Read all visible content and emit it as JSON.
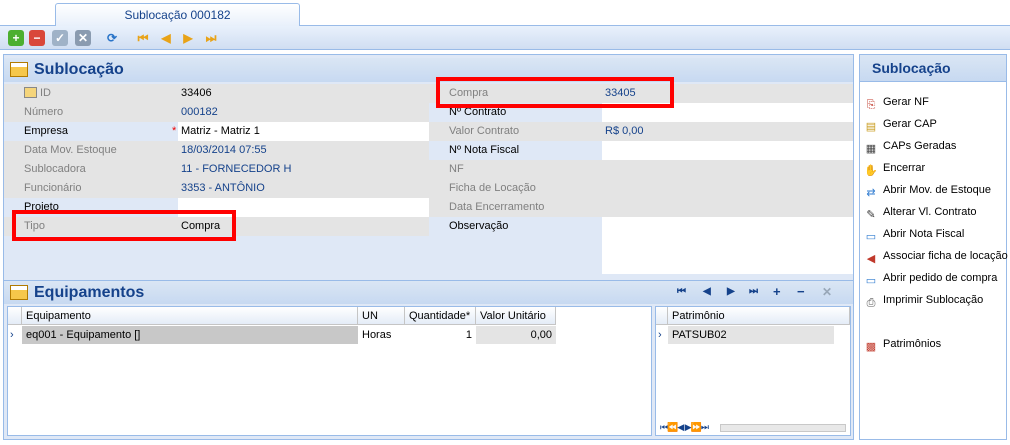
{
  "tab": {
    "title": "Sublocação 000182"
  },
  "toolbar": {
    "buttons": [
      "plus-icon",
      "minus-icon",
      "check-icon",
      "cancel-icon",
      "refresh-icon",
      "first-icon",
      "prev-icon",
      "next-icon",
      "last-icon"
    ]
  },
  "sublocacao": {
    "title": "Sublocação",
    "left": [
      {
        "label": "ID",
        "value": "33406"
      },
      {
        "label": "Número",
        "value": "000182"
      },
      {
        "label": "Empresa",
        "value": "Matriz - Matriz 1"
      },
      {
        "label": "Data Mov. Estoque",
        "value": "18/03/2014 07:55"
      },
      {
        "label": "Sublocadora",
        "value": "11 - FORNECEDOR H"
      },
      {
        "label": "Funcionário",
        "value": "3353 - ANTÔNIO"
      },
      {
        "label": "Projeto",
        "value": ""
      },
      {
        "label": "Tipo",
        "value": "Compra"
      }
    ],
    "required_marker": "*",
    "right": [
      {
        "label": "Compra",
        "value": "33405"
      },
      {
        "label": "Nº Contrato",
        "value": ""
      },
      {
        "label": "Valor Contrato",
        "value": "R$ 0,00"
      },
      {
        "label": "Nº Nota Fiscal",
        "value": ""
      },
      {
        "label": "NF",
        "value": ""
      },
      {
        "label": "Ficha de Locação",
        "value": ""
      },
      {
        "label": "Data Encerramento",
        "value": ""
      },
      {
        "label": "Observação",
        "value": ""
      }
    ]
  },
  "equipamentos": {
    "title": "Equipamentos",
    "nav": [
      "⏮",
      "◀",
      "▶",
      "⏭",
      "+",
      "−",
      "✕"
    ],
    "columns": [
      "Equipamento",
      "UN",
      "Quantidade*",
      "Valor Unitário"
    ],
    "rows": [
      {
        "equipamento": "eq001 - Equipamento []",
        "un": "Horas",
        "quantidade": "1",
        "valor": "0,00"
      }
    ],
    "patrimonio_column": "Patrimônio",
    "patrimonio_rows": [
      "PATSUB02"
    ],
    "patrimonio_nav": "⏮⏪◀ ▶⏩⏭"
  },
  "side": {
    "title": "Sublocação",
    "items": [
      {
        "label": "Gerar NF",
        "icon": "gerar-nf-icon"
      },
      {
        "label": "Gerar CAP",
        "icon": "gerar-cap-icon"
      },
      {
        "label": "CAPs Geradas",
        "icon": "caps-geradas-icon"
      },
      {
        "label": "Encerrar",
        "icon": "encerrar-icon"
      },
      {
        "label": "Abrir Mov. de Estoque",
        "icon": "mov-estoque-icon"
      },
      {
        "label": "Alterar Vl. Contrato",
        "icon": "alterar-contrato-icon"
      },
      {
        "label": "Abrir Nota Fiscal",
        "icon": "nota-fiscal-icon"
      },
      {
        "label": "Associar ficha de locação",
        "icon": "associar-ficha-icon"
      },
      {
        "label": "Abrir pedido de compra",
        "icon": "pedido-compra-icon"
      },
      {
        "label": "Imprimir Sublocação",
        "icon": "printer-icon"
      },
      {
        "label": "Patrimônios",
        "icon": "patrimonios-icon"
      }
    ]
  },
  "colors": {
    "highlight": "#ff0000",
    "header": "#15428b",
    "panel": "#dfe8f6"
  }
}
